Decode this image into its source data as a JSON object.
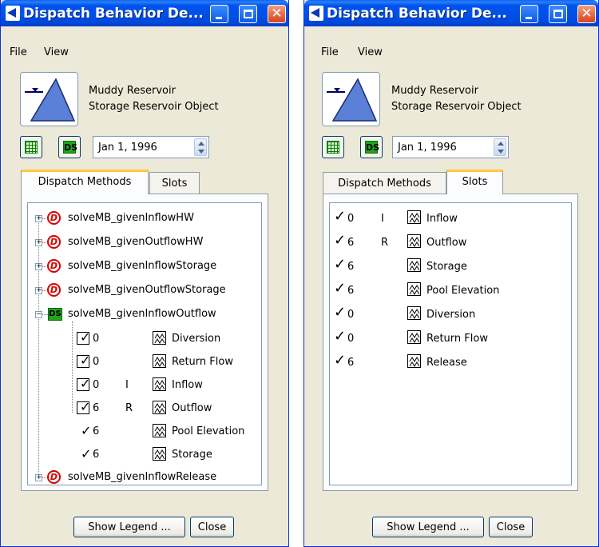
{
  "windows": [
    {
      "title": "Dispatch Behavior De...",
      "menu": [
        "File",
        "View"
      ],
      "object_name": "Muddy Reservoir",
      "object_type": "Storage Reservoir Object",
      "date": "Jan 1, 1996",
      "tabs": [
        "Dispatch Methods",
        "Slots"
      ],
      "active_tab": "Dispatch Methods",
      "methods": [
        {
          "name": "solveMB_givenInflowHW",
          "status": "no-icon"
        },
        {
          "name": "solveMB_givenOutflowHW",
          "status": "no-icon"
        },
        {
          "name": "solveMB_givenInflowStorage",
          "status": "no-icon"
        },
        {
          "name": "solveMB_givenOutflowStorage",
          "status": "no-icon"
        },
        {
          "name": "solveMB_givenInflowOutflow",
          "status": "ds-icon",
          "expanded": true,
          "slots": [
            {
              "check": "box",
              "num": "0",
              "flag": "",
              "name": "Diversion"
            },
            {
              "check": "box",
              "num": "0",
              "flag": "",
              "name": "Return Flow"
            },
            {
              "check": "box",
              "num": "0",
              "flag": "I",
              "name": "Inflow"
            },
            {
              "check": "box",
              "num": "6",
              "flag": "R",
              "name": "Outflow"
            },
            {
              "check": "tick",
              "num": "6",
              "flag": "",
              "name": "Pool Elevation"
            },
            {
              "check": "tick",
              "num": "6",
              "flag": "",
              "name": "Storage"
            }
          ]
        },
        {
          "name": "solveMB_givenInflowRelease",
          "status": "no-icon"
        }
      ],
      "buttons": {
        "legend": "Show Legend ...",
        "close": "Close"
      }
    },
    {
      "title": "Dispatch Behavior De...",
      "menu": [
        "File",
        "View"
      ],
      "object_name": "Muddy Reservoir",
      "object_type": "Storage Reservoir Object",
      "date": "Jan 1, 1996",
      "tabs": [
        "Dispatch Methods",
        "Slots"
      ],
      "active_tab": "Slots",
      "slots": [
        {
          "num": "0",
          "flag": "I",
          "name": "Inflow"
        },
        {
          "num": "6",
          "flag": "R",
          "name": "Outflow"
        },
        {
          "num": "6",
          "flag": "",
          "name": "Storage"
        },
        {
          "num": "6",
          "flag": "",
          "name": "Pool Elevation"
        },
        {
          "num": "0",
          "flag": "",
          "name": "Diversion"
        },
        {
          "num": "0",
          "flag": "",
          "name": "Return Flow"
        },
        {
          "num": "6",
          "flag": "",
          "name": "Release"
        }
      ],
      "buttons": {
        "legend": "Show Legend ...",
        "close": "Close"
      }
    }
  ],
  "colors": {
    "titlebar": "#0053ee",
    "accent_tab": "#ffc83c",
    "ds_green": "#1fa51f",
    "no_red": "#d40000"
  },
  "icons": {
    "check": "✓",
    "ds": "DS",
    "no": "D",
    "expand": "+",
    "collapse": "−"
  }
}
